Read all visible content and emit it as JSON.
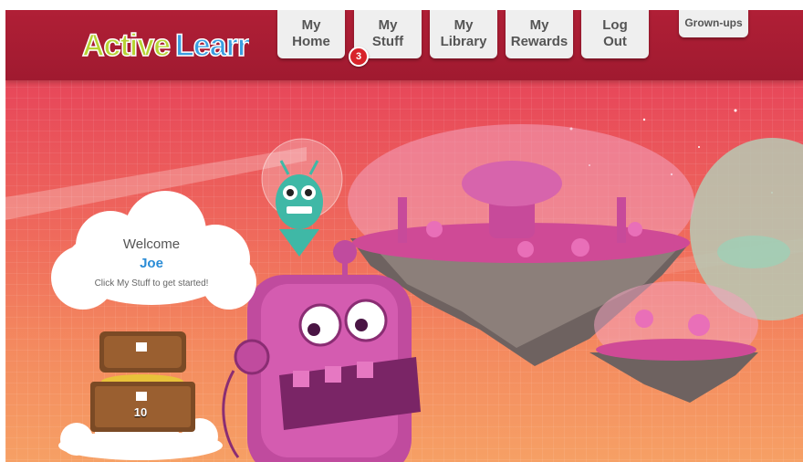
{
  "app": {
    "logo_text": "ActiveLearn"
  },
  "nav": {
    "my_home": [
      "My",
      "Home"
    ],
    "my_stuff": [
      "My",
      "Stuff"
    ],
    "my_library": [
      "My",
      "Library"
    ],
    "my_rewards": [
      "My",
      "Rewards"
    ],
    "log_out": [
      "Log",
      "Out"
    ],
    "grownups": "Grown-ups",
    "stuff_badge": "3"
  },
  "welcome": {
    "title": "Welcome",
    "name": "Joe",
    "hint": "Click My Stuff to get started!"
  },
  "chest": {
    "count": "10"
  },
  "colors": {
    "topbar": "#a51b32",
    "logo_green": "#b7d334",
    "logo_blue": "#3a9ee0",
    "name_blue": "#2a8cd6",
    "badge_red": "#d8232a"
  }
}
